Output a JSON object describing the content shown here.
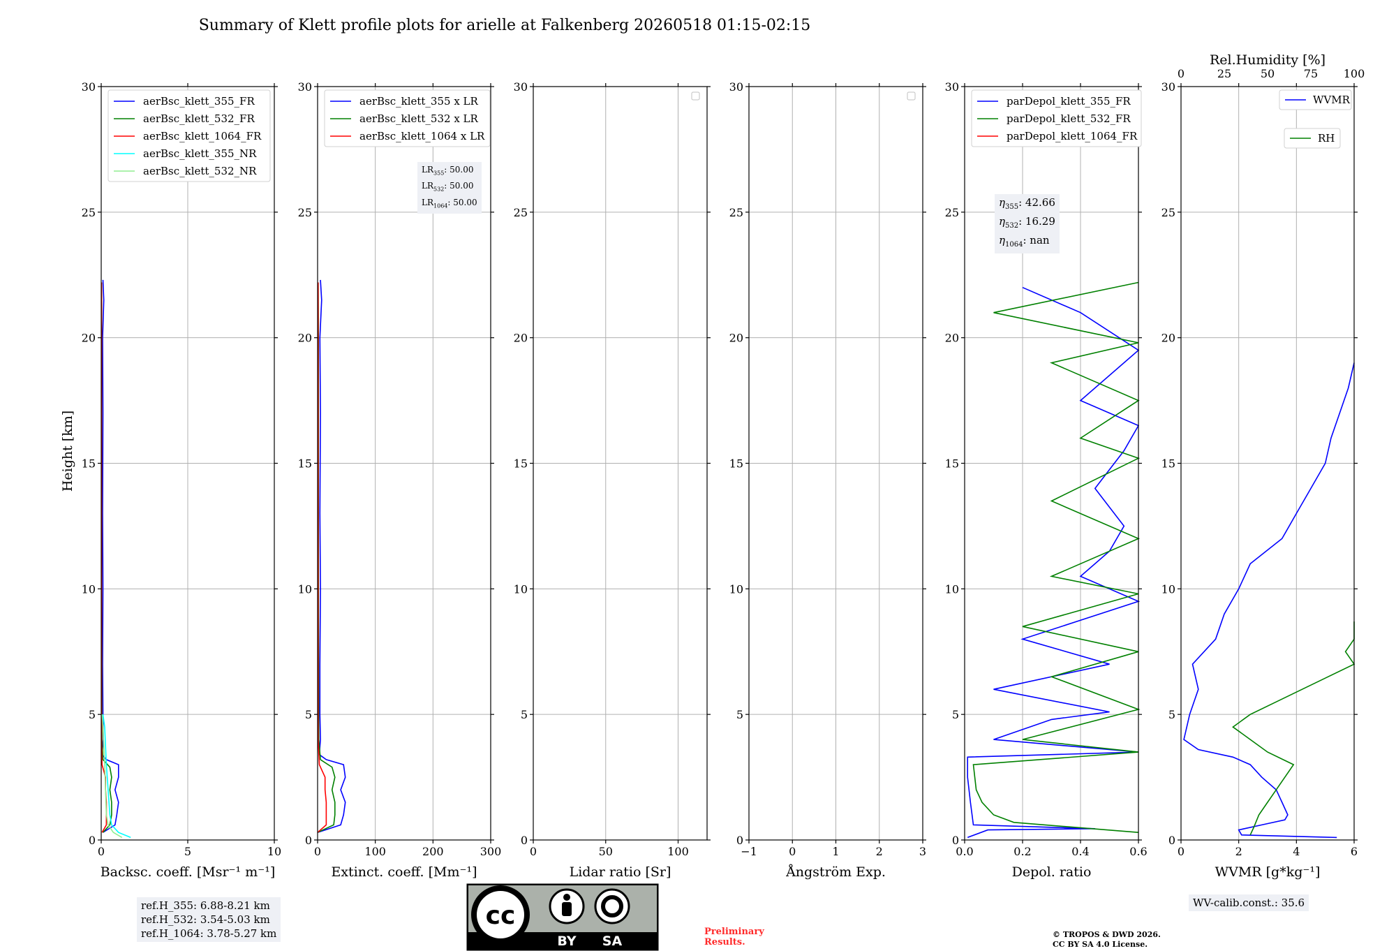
{
  "title": "Summary of Klett profile plots for arielle at Falkenberg 20260518 01:15-02:15",
  "ylabel": "Height [km]",
  "colors": {
    "blue": "#0000ff",
    "green": "#008000",
    "red": "#ff0000",
    "cyan": "#00ffff",
    "lightgreen": "#90ee90",
    "grid": "#b0b0b0",
    "box": "#eef0f5",
    "prelim": "#ff2a2a"
  },
  "panels": [
    {
      "xlabel": "Backsc. coeff. [Msr⁻¹ m⁻¹]",
      "ticks": [
        "0",
        "5",
        "10"
      ],
      "legend": [
        "aerBsc_klett_355_FR",
        "aerBsc_klett_532_FR",
        "aerBsc_klett_1064_FR",
        "aerBsc_klett_355_NR",
        "aerBsc_klett_532_NR"
      ]
    },
    {
      "xlabel": "Extinct. coeff. [Mm⁻¹]",
      "ticks": [
        "0",
        "100",
        "200",
        "300"
      ],
      "legend": [
        "aerBsc_klett_355 x LR",
        "aerBsc_klett_532 x LR",
        "aerBsc_klett_1064 x LR"
      ]
    },
    {
      "xlabel": "Lidar ratio [Sr]",
      "ticks": [
        "0",
        "50",
        "100"
      ],
      "legend": []
    },
    {
      "xlabel": "Ångström Exp.",
      "ticks": [
        "−1",
        "0",
        "1",
        "2",
        "3"
      ],
      "legend": []
    },
    {
      "xlabel": "Depol. ratio",
      "ticks": [
        "0.0",
        "0.2",
        "0.4",
        "0.6"
      ],
      "legend": [
        "parDepol_klett_355_FR",
        "parDepol_klett_532_FR",
        "parDepol_klett_1064_FR"
      ]
    },
    {
      "xlabel": "WVMR [g*kg⁻¹]",
      "ticks": [
        "0",
        "2",
        "4",
        "6"
      ],
      "top_label": "Rel.Humidity [%]",
      "top_ticks": [
        "0",
        "25",
        "50",
        "75",
        "100"
      ],
      "legend": [
        "WVMR",
        "RH"
      ]
    }
  ],
  "yticks": [
    "0",
    "5",
    "10",
    "15",
    "20",
    "25",
    "30"
  ],
  "boxes": {
    "refh": [
      "ref.H_355: 6.88-8.21 km",
      "ref.H_532: 3.54-5.03 km",
      "ref.H_1064: 3.78-5.27 km"
    ],
    "lr": {
      "label": "LR",
      "sub": [
        "355",
        "532",
        "1064"
      ],
      "values": [
        "50.00",
        "50.00",
        "50.00"
      ]
    },
    "eta": {
      "label": "η",
      "sub": [
        "355",
        "532",
        "1064"
      ],
      "values": [
        "42.66",
        "16.29",
        "nan"
      ]
    },
    "wv": "WV-calib.const.: 35.6"
  },
  "cc_logo": {
    "cc": "cc",
    "by": "BY",
    "sa": "SA"
  },
  "preliminary": "Preliminary\nResults.",
  "copyright": "© TROPOS & DWD 2026.\nCC BY SA 4.0 License.",
  "chart_data": [
    {
      "type": "line",
      "xlabel": "Backsc. coeff. [Msr⁻¹ m⁻¹]",
      "ylabel": "Height [km]",
      "xlim": [
        0,
        10
      ],
      "ylim": [
        0,
        30
      ],
      "grid": true,
      "legend_position": "top-left",
      "series": [
        {
          "name": "aerBsc_klett_355_FR",
          "color": "#0000ff",
          "points": [
            [
              0.1,
              0.3
            ],
            [
              0.8,
              0.6
            ],
            [
              0.9,
              1.0
            ],
            [
              1.0,
              1.5
            ],
            [
              0.8,
              2.0
            ],
            [
              1.0,
              2.5
            ],
            [
              1.0,
              3.0
            ],
            [
              0.3,
              3.2
            ],
            [
              0.05,
              3.4
            ],
            [
              0.12,
              4.0
            ],
            [
              0.1,
              5.0
            ],
            [
              0.08,
              7.0
            ],
            [
              0.1,
              10.0
            ],
            [
              0.08,
              13.0
            ],
            [
              0.1,
              17.0
            ],
            [
              0.08,
              20.0
            ],
            [
              0.15,
              21.5
            ],
            [
              0.1,
              22.3
            ]
          ]
        },
        {
          "name": "aerBsc_klett_532_FR",
          "color": "#008000",
          "points": [
            [
              0.1,
              0.3
            ],
            [
              0.5,
              0.6
            ],
            [
              0.6,
              1.0
            ],
            [
              0.6,
              1.5
            ],
            [
              0.5,
              2.0
            ],
            [
              0.6,
              2.5
            ],
            [
              0.5,
              2.9
            ],
            [
              0.1,
              3.2
            ],
            [
              0.04,
              4.0
            ],
            [
              0.03,
              10.0
            ],
            [
              0.03,
              20.0
            ],
            [
              0.02,
              22.2
            ]
          ]
        },
        {
          "name": "aerBsc_klett_1064_FR",
          "color": "#ff0000",
          "points": [
            [
              0.05,
              0.3
            ],
            [
              0.3,
              0.6
            ],
            [
              0.3,
              1.0
            ],
            [
              0.3,
              1.5
            ],
            [
              0.25,
              2.0
            ],
            [
              0.25,
              2.5
            ],
            [
              0.05,
              3.0
            ],
            [
              0.02,
              4.0
            ],
            [
              0.02,
              10.0
            ],
            [
              0.02,
              20.0
            ],
            [
              0.02,
              22.2
            ]
          ]
        },
        {
          "name": "aerBsc_klett_355_NR",
          "color": "#00ffff",
          "points": [
            [
              1.7,
              0.1
            ],
            [
              1.0,
              0.3
            ],
            [
              0.6,
              0.6
            ],
            [
              0.5,
              1.0
            ],
            [
              0.3,
              3.0
            ],
            [
              0.2,
              4.5
            ],
            [
              0.1,
              5.0
            ]
          ]
        },
        {
          "name": "aerBsc_klett_532_NR",
          "color": "#90ee90",
          "points": [
            [
              1.2,
              0.1
            ],
            [
              0.7,
              0.3
            ],
            [
              0.4,
              0.6
            ],
            [
              0.3,
              1.0
            ],
            [
              0.2,
              3.0
            ],
            [
              0.1,
              4.5
            ],
            [
              0.05,
              5.0
            ]
          ]
        }
      ]
    },
    {
      "type": "line",
      "xlabel": "Extinct. coeff. [Mm⁻¹]",
      "xlim": [
        0,
        300
      ],
      "ylim": [
        0,
        30
      ],
      "grid": true,
      "legend_position": "top-left",
      "series": [
        {
          "name": "aerBsc_klett_355 x LR",
          "color": "#0000ff",
          "points": [
            [
              0,
              0.3
            ],
            [
              40,
              0.6
            ],
            [
              45,
              1.0
            ],
            [
              48,
              1.5
            ],
            [
              40,
              2.0
            ],
            [
              48,
              2.5
            ],
            [
              45,
              3.0
            ],
            [
              15,
              3.2
            ],
            [
              3,
              3.4
            ],
            [
              5,
              4.0
            ],
            [
              4,
              5.0
            ],
            [
              4,
              7.0
            ],
            [
              5,
              10.0
            ],
            [
              4,
              13.0
            ],
            [
              5,
              17.0
            ],
            [
              4,
              20.0
            ],
            [
              7,
              21.5
            ],
            [
              5,
              22.3
            ]
          ]
        },
        {
          "name": "aerBsc_klett_532 x LR",
          "color": "#008000",
          "points": [
            [
              0,
              0.3
            ],
            [
              28,
              0.6
            ],
            [
              30,
              1.0
            ],
            [
              30,
              1.5
            ],
            [
              25,
              2.0
            ],
            [
              30,
              2.5
            ],
            [
              25,
              2.9
            ],
            [
              5,
              3.2
            ],
            [
              2,
              4.0
            ],
            [
              1.5,
              10.0
            ],
            [
              1.5,
              20.0
            ],
            [
              1,
              22.2
            ]
          ]
        },
        {
          "name": "aerBsc_klett_1064 x LR",
          "color": "#ff0000",
          "points": [
            [
              0,
              0.3
            ],
            [
              15,
              0.6
            ],
            [
              15,
              1.0
            ],
            [
              15,
              1.5
            ],
            [
              13,
              2.0
            ],
            [
              13,
              2.5
            ],
            [
              3,
              3.0
            ],
            [
              1,
              4.0
            ],
            [
              1,
              10.0
            ],
            [
              1,
              20.0
            ],
            [
              1,
              22.2
            ]
          ]
        }
      ]
    },
    {
      "type": "line",
      "xlabel": "Lidar ratio [Sr]",
      "xlim": [
        0,
        120
      ],
      "ylim": [
        0,
        30
      ],
      "grid": true,
      "series": []
    },
    {
      "type": "line",
      "xlabel": "Ångström Exp.",
      "xlim": [
        -1,
        3
      ],
      "ylim": [
        0,
        30
      ],
      "grid": true,
      "series": []
    },
    {
      "type": "line",
      "xlabel": "Depol. ratio",
      "xlim": [
        0,
        0.6
      ],
      "ylim": [
        0,
        30
      ],
      "grid": true,
      "legend_position": "top-left",
      "series": [
        {
          "name": "parDepol_klett_355_FR",
          "color": "#0000ff",
          "points": [
            [
              0.01,
              0.1
            ],
            [
              0.08,
              0.4
            ],
            [
              0.45,
              0.45
            ],
            [
              0.03,
              0.6
            ],
            [
              0.02,
              1.5
            ],
            [
              0.01,
              2.5
            ],
            [
              0.01,
              3.3
            ],
            [
              0.6,
              3.5
            ],
            [
              0.1,
              4.0
            ],
            [
              0.3,
              4.8
            ],
            [
              0.5,
              5.1
            ],
            [
              0.1,
              6.0
            ],
            [
              0.5,
              7.0
            ],
            [
              0.2,
              8.0
            ],
            [
              0.6,
              9.5
            ],
            [
              0.4,
              10.5
            ],
            [
              0.5,
              11.5
            ],
            [
              0.55,
              12.5
            ],
            [
              0.45,
              14.0
            ],
            [
              0.55,
              15.5
            ],
            [
              0.6,
              16.5
            ],
            [
              0.4,
              17.5
            ],
            [
              0.6,
              19.5
            ],
            [
              0.4,
              21.0
            ],
            [
              0.2,
              22.0
            ]
          ]
        },
        {
          "name": "parDepol_klett_532_FR",
          "color": "#008000",
          "points": [
            [
              0.6,
              0.3
            ],
            [
              0.17,
              0.7
            ],
            [
              0.1,
              1.0
            ],
            [
              0.06,
              1.5
            ],
            [
              0.04,
              2.0
            ],
            [
              0.03,
              3.0
            ],
            [
              0.6,
              3.5
            ],
            [
              0.2,
              4.0
            ],
            [
              0.6,
              5.2
            ],
            [
              0.3,
              6.5
            ],
            [
              0.6,
              7.5
            ],
            [
              0.2,
              8.5
            ],
            [
              0.6,
              9.8
            ],
            [
              0.3,
              10.5
            ],
            [
              0.6,
              12.0
            ],
            [
              0.3,
              13.5
            ],
            [
              0.6,
              15.2
            ],
            [
              0.4,
              16.0
            ],
            [
              0.6,
              17.5
            ],
            [
              0.3,
              19.0
            ],
            [
              0.6,
              19.8
            ],
            [
              0.1,
              21.0
            ],
            [
              0.6,
              22.2
            ]
          ]
        },
        {
          "name": "parDepol_klett_1064_FR",
          "color": "#ff0000",
          "points": []
        }
      ]
    },
    {
      "type": "line",
      "xlabel": "WVMR [g*kg⁻¹]",
      "x2label": "Rel.Humidity [%]",
      "xlim": [
        0,
        6
      ],
      "x2lim": [
        0,
        100
      ],
      "ylim": [
        0,
        30
      ],
      "grid": true,
      "legend_position": "top-right",
      "series": [
        {
          "name": "WVMR",
          "axis": "x",
          "color": "#0000ff",
          "points": [
            [
              5.4,
              0.1
            ],
            [
              2.1,
              0.2
            ],
            [
              2.0,
              0.4
            ],
            [
              2.8,
              0.6
            ],
            [
              3.6,
              0.8
            ],
            [
              3.7,
              1.0
            ],
            [
              3.5,
              1.5
            ],
            [
              3.3,
              2.0
            ],
            [
              2.8,
              2.5
            ],
            [
              2.4,
              3.0
            ],
            [
              1.8,
              3.3
            ],
            [
              0.6,
              3.6
            ],
            [
              0.1,
              4.0
            ],
            [
              0.3,
              5.0
            ],
            [
              0.6,
              6.0
            ],
            [
              0.4,
              7.0
            ],
            [
              1.2,
              8.0
            ],
            [
              1.5,
              9.0
            ],
            [
              2.0,
              10.0
            ],
            [
              2.4,
              11.0
            ],
            [
              3.5,
              12.0
            ],
            [
              4.0,
              13.0
            ],
            [
              4.5,
              14.0
            ],
            [
              5.0,
              15.0
            ],
            [
              5.2,
              16.0
            ],
            [
              5.5,
              17.0
            ],
            [
              5.8,
              18.0
            ],
            [
              6.0,
              19.0
            ]
          ]
        },
        {
          "name": "RH",
          "axis": "x2",
          "color": "#008000",
          "points": [
            [
              40,
              0.2
            ],
            [
              42,
              0.5
            ],
            [
              45,
              1.0
            ],
            [
              50,
              1.5
            ],
            [
              55,
              2.0
            ],
            [
              60,
              2.5
            ],
            [
              65,
              3.0
            ],
            [
              50,
              3.5
            ],
            [
              40,
              4.0
            ],
            [
              30,
              4.5
            ],
            [
              40,
              5.0
            ],
            [
              55,
              5.5
            ],
            [
              70,
              6.0
            ],
            [
              85,
              6.5
            ],
            [
              100,
              7.0
            ],
            [
              95,
              7.5
            ],
            [
              100,
              8.0
            ],
            [
              100,
              8.7
            ]
          ]
        }
      ]
    }
  ]
}
